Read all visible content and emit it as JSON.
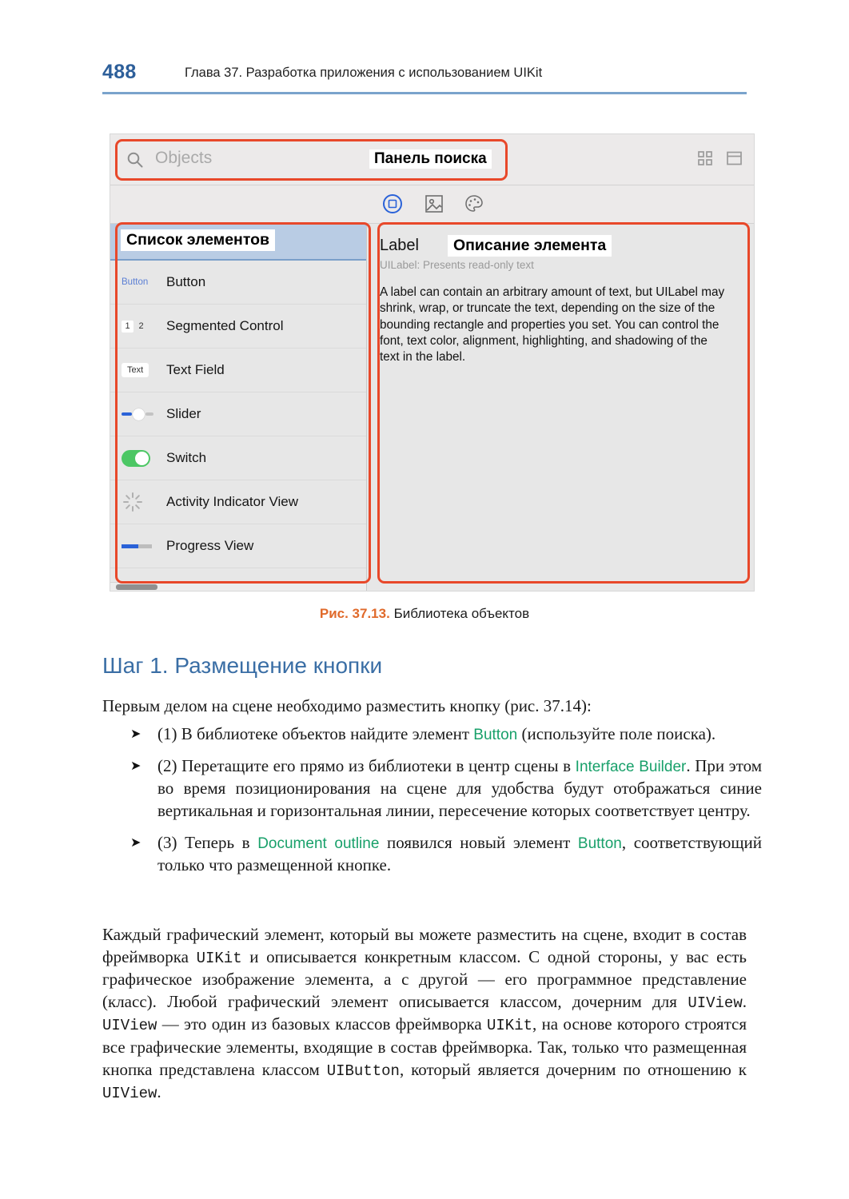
{
  "page": {
    "number": "488",
    "running_head": "Глава 37. Разработка приложения с использованием UIKit"
  },
  "figure": {
    "search": {
      "placeholder": "Objects",
      "annotation": "Панель поиска",
      "icon": "search-icon"
    },
    "topright_icons": [
      "grid-view-icon",
      "panel-view-icon"
    ],
    "tab_icons": [
      "object-library-icon",
      "media-library-icon",
      "color-palette-icon"
    ],
    "list": {
      "annotation": "Список элементов",
      "items": [
        {
          "icon": "button-icon",
          "label": "Button"
        },
        {
          "icon": "segmented-control-icon",
          "label": "Segmented Control"
        },
        {
          "icon": "text-field-icon",
          "label": "Text Field"
        },
        {
          "icon": "slider-icon",
          "label": "Slider"
        },
        {
          "icon": "switch-icon",
          "label": "Switch"
        },
        {
          "icon": "activity-indicator-icon",
          "label": "Activity Indicator View"
        },
        {
          "icon": "progress-view-icon",
          "label": "Progress View"
        }
      ],
      "segmented_labels": [
        "1",
        "2"
      ],
      "text_field_label": "Text",
      "button_icon_label": "Button"
    },
    "detail": {
      "title": "Label",
      "annotation": "Описание элемента",
      "subtitle": "UILabel: Presents read-only text",
      "body": "A label can contain an arbitrary amount of text, but UILabel may shrink, wrap, or truncate the text, depending on the size of the bounding rectangle and properties you set. You can control the font, text color, alignment, highlighting, and shadowing of the text in the label."
    },
    "colors": {
      "annotation_box": "#e8482a",
      "selection": "#b9cce4",
      "accent_blue": "#2a62d8",
      "switch_green": "#4cc764"
    }
  },
  "caption": {
    "number": "Рис. 37.13.",
    "text": "Библиотека объектов"
  },
  "section": {
    "heading": "Шаг 1. Размещение кнопки",
    "intro": "Первым делом на сцене необходимо разместить кнопку (рис. 37.14):",
    "steps": [
      {
        "marker": "➤",
        "parts": [
          {
            "type": "text",
            "value": "(1) В библиотеке объектов найдите элемент "
          },
          {
            "type": "keyword",
            "value": "Button"
          },
          {
            "type": "text",
            "value": " (используйте поле поиска)."
          }
        ]
      },
      {
        "marker": "➤",
        "parts": [
          {
            "type": "text",
            "value": "(2) Перетащите его прямо из библиотеки в центр сцены в "
          },
          {
            "type": "keyword",
            "value": "Interface Builder"
          },
          {
            "type": "text",
            "value": ". При этом во время позиционирования на сцене для удобства будут отображаться синие вертикальная и горизонтальная линии, пересечение которых соответствует центру."
          }
        ]
      },
      {
        "marker": "➤",
        "parts": [
          {
            "type": "text",
            "value": "(3) Теперь в "
          },
          {
            "type": "keyword",
            "value": "Document outline"
          },
          {
            "type": "text",
            "value": " появился новый элемент "
          },
          {
            "type": "keyword",
            "value": "Button"
          },
          {
            "type": "text",
            "value": ", соответствующий только что размещенной кнопке."
          }
        ]
      }
    ],
    "final_paragraph": [
      {
        "type": "text",
        "value": "Каждый графический элемент, который вы можете разместить на сцене, входит в состав фреймворка "
      },
      {
        "type": "code",
        "value": "UIKit"
      },
      {
        "type": "text",
        "value": " и описывается конкретным классом. С одной стороны, у вас есть графическое изображение элемента, а с другой — его программное представление (класс). Любой графический элемент описывается классом, дочерним для "
      },
      {
        "type": "code",
        "value": "UIView"
      },
      {
        "type": "text",
        "value": ". "
      },
      {
        "type": "code",
        "value": "UIView"
      },
      {
        "type": "text",
        "value": " — это один из базовых классов фреймворка "
      },
      {
        "type": "code",
        "value": "UIKit"
      },
      {
        "type": "text",
        "value": ", на основе которого строятся все графические элементы, входящие в состав фреймворка. Так, только что размещенная кнопка представлена классом "
      },
      {
        "type": "code",
        "value": "UIButton"
      },
      {
        "type": "text",
        "value": ", который является дочерним по отношению к "
      },
      {
        "type": "code",
        "value": "UIView"
      },
      {
        "type": "text",
        "value": "."
      }
    ]
  },
  "colors": {
    "heading_blue": "#3a6ea5",
    "page_number_blue": "#2d5f9a",
    "caption_orange": "#e06a2b",
    "keyword_green": "#18a06a"
  }
}
